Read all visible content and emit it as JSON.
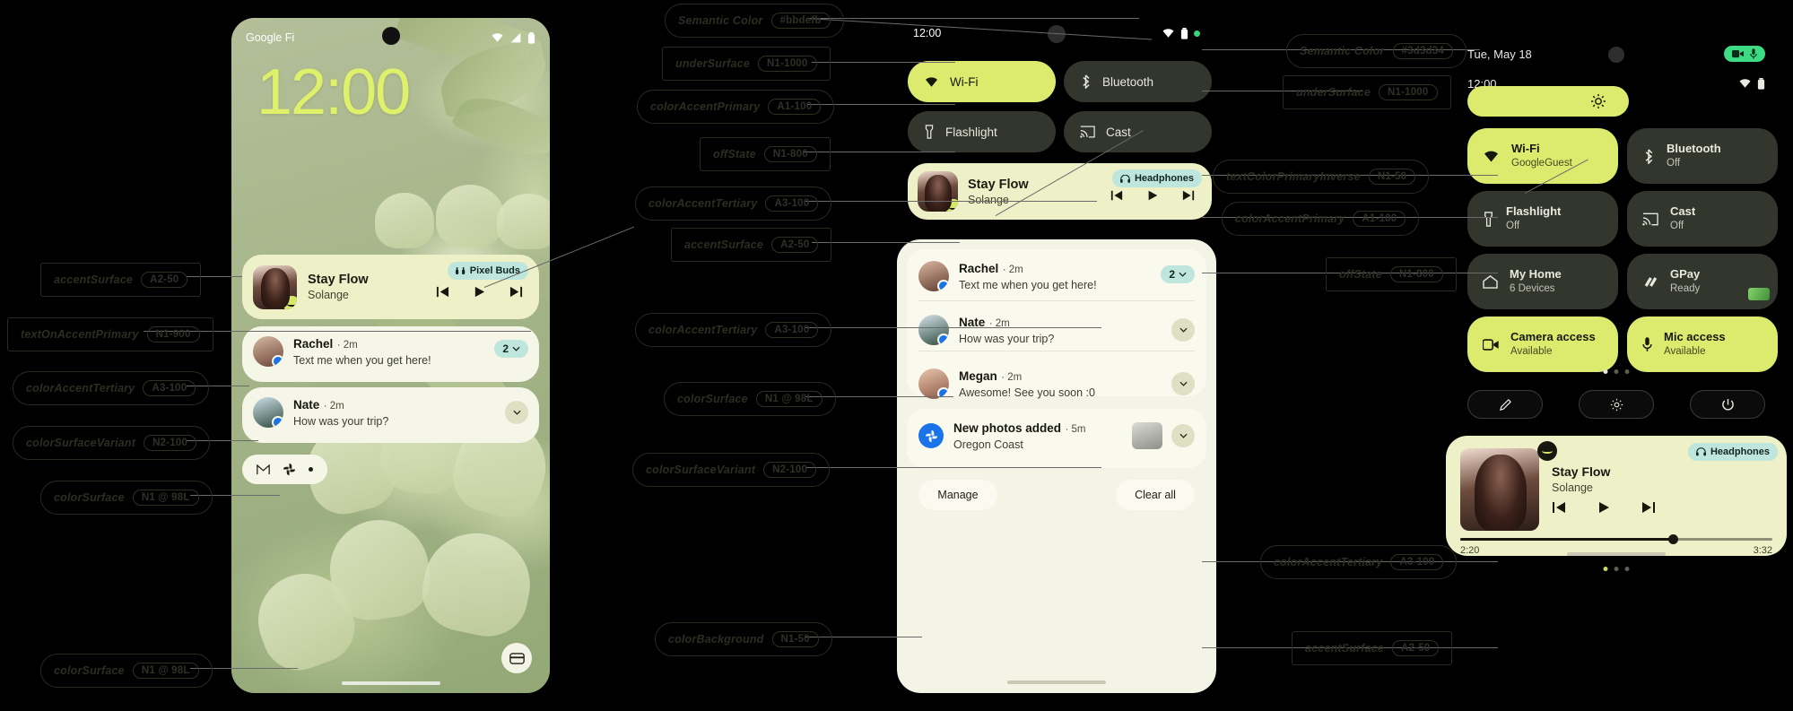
{
  "annotations": {
    "left_column": [
      {
        "label": "accentSurface",
        "token": "A2-50",
        "shape": "rect"
      },
      {
        "label": "textOnAccentPrimary",
        "token": "N1-900",
        "shape": "rect"
      },
      {
        "label": "colorAccentTertiary",
        "token": "A3-100",
        "shape": "pill"
      },
      {
        "label": "colorSurfaceVariant",
        "token": "N2-100",
        "shape": "pill"
      },
      {
        "label": "colorSurface",
        "token": "N1 @ 98L",
        "shape": "pill"
      },
      {
        "label": "colorSurface",
        "token": "N1 @ 98L",
        "shape": "pill"
      }
    ],
    "middle_column": [
      {
        "label": "Semantic Color",
        "token": "#bbdefb",
        "shape": "pill"
      },
      {
        "label": "underSurface",
        "token": "N1-1000",
        "shape": "rect"
      },
      {
        "label": "colorAccentPrimary",
        "token": "A1-100",
        "shape": "pill"
      },
      {
        "label": "offState",
        "token": "N1-800",
        "shape": "rect"
      },
      {
        "label": "colorAccentTertiary",
        "token": "A3-100",
        "shape": "pill"
      },
      {
        "label": "accentSurface",
        "token": "A2-50",
        "shape": "rect"
      },
      {
        "label": "colorAccentTertiary",
        "token": "A3-100",
        "shape": "pill"
      },
      {
        "label": "colorSurface",
        "token": "N1 @ 98L",
        "shape": "pill"
      },
      {
        "label": "colorSurfaceVariant",
        "token": "N2-100",
        "shape": "pill"
      },
      {
        "label": "colorBackground",
        "token": "N1-50",
        "shape": "pill"
      }
    ],
    "right_column": [
      {
        "label": "Semantic Color",
        "token": "#3d3d34",
        "shape": "pill"
      },
      {
        "label": "underSurface",
        "token": "N1-1000",
        "shape": "rect"
      },
      {
        "label": "textColorPrimaryInverse",
        "token": "N1-50",
        "shape": "pill"
      },
      {
        "label": "colorAccentPrimary",
        "token": "A1-100",
        "shape": "pill"
      },
      {
        "label": "offState",
        "token": "N1-800",
        "shape": "rect"
      },
      {
        "label": "colorAccentTertiary",
        "token": "A3-100",
        "shape": "pill"
      },
      {
        "label": "accentSurface",
        "token": "A2-50",
        "shape": "rect"
      }
    ]
  },
  "phone_lockscreen": {
    "carrier": "Google Fi",
    "clock": "12:00",
    "media": {
      "title": "Stay Flow",
      "artist": "Solange",
      "device_chip": "Pixel Buds"
    },
    "notifications": [
      {
        "name": "Rachel",
        "time": "2m",
        "body": "Text me when you get here!",
        "count": "2"
      },
      {
        "name": "Nate",
        "time": "2m",
        "body": "How was your trip?",
        "count": ""
      }
    ]
  },
  "phone_quicksettings": {
    "clock": "12:00",
    "tiles": [
      {
        "label": "Wi-Fi",
        "icon": "wifi-icon",
        "state": "on"
      },
      {
        "label": "Bluetooth",
        "icon": "bluetooth-icon",
        "state": "off"
      },
      {
        "label": "Flashlight",
        "icon": "flashlight-icon",
        "state": "off"
      },
      {
        "label": "Cast",
        "icon": "cast-icon",
        "state": "off"
      }
    ],
    "media": {
      "title": "Stay Flow",
      "artist": "Solange",
      "device_chip": "Headphones"
    },
    "notifications": [
      {
        "name": "Rachel",
        "time": "2m",
        "body": "Text me when you get here!",
        "count": "2"
      },
      {
        "name": "Nate",
        "time": "2m",
        "body": "How was your trip?",
        "count": ""
      },
      {
        "name": "Megan",
        "time": "2m",
        "body": "Awesome! See you soon :0",
        "count": ""
      }
    ],
    "photo_notification": {
      "title": "New photos added",
      "time": "5m",
      "body": "Oregon Coast"
    },
    "manage_label": "Manage",
    "clear_all_label": "Clear all"
  },
  "phone_quicksettings_full": {
    "date": "Tue, May 18",
    "clock": "12:00",
    "tiles": [
      {
        "label": "Wi-Fi",
        "sub": "GoogleGuest",
        "icon": "wifi-icon",
        "state": "on"
      },
      {
        "label": "Bluetooth",
        "sub": "Off",
        "icon": "bluetooth-icon",
        "state": "off"
      },
      {
        "label": "Flashlight",
        "sub": "Off",
        "icon": "flashlight-icon",
        "state": "off"
      },
      {
        "label": "Cast",
        "sub": "Off",
        "icon": "cast-icon",
        "state": "off"
      },
      {
        "label": "My Home",
        "sub": "6 Devices",
        "icon": "home-icon",
        "state": "off"
      },
      {
        "label": "GPay",
        "sub": "Ready",
        "icon": "gpay-icon",
        "state": "off"
      },
      {
        "label": "Camera access",
        "sub": "Available",
        "icon": "camera-icon",
        "state": "on"
      },
      {
        "label": "Mic access",
        "sub": "Available",
        "icon": "mic-icon",
        "state": "on"
      }
    ],
    "actions": [
      {
        "name": "edit-button",
        "icon": "pencil-icon"
      },
      {
        "name": "settings-button",
        "icon": "gear-icon"
      },
      {
        "name": "power-button",
        "icon": "power-icon"
      }
    ],
    "player": {
      "title": "Stay Flow",
      "artist": "Solange",
      "device_chip": "Headphones",
      "elapsed": "2:20",
      "duration": "3:32",
      "progress_pct": 68
    }
  },
  "colors": {
    "accent_green": "#dceb6e",
    "accent_surface": "#eef0c8",
    "surface": "#f6f6e8",
    "off_state": "#33362c",
    "under_surface": "#000000",
    "teal_chip": "#bfe6dc",
    "privacy_green": "#3ddc84"
  }
}
